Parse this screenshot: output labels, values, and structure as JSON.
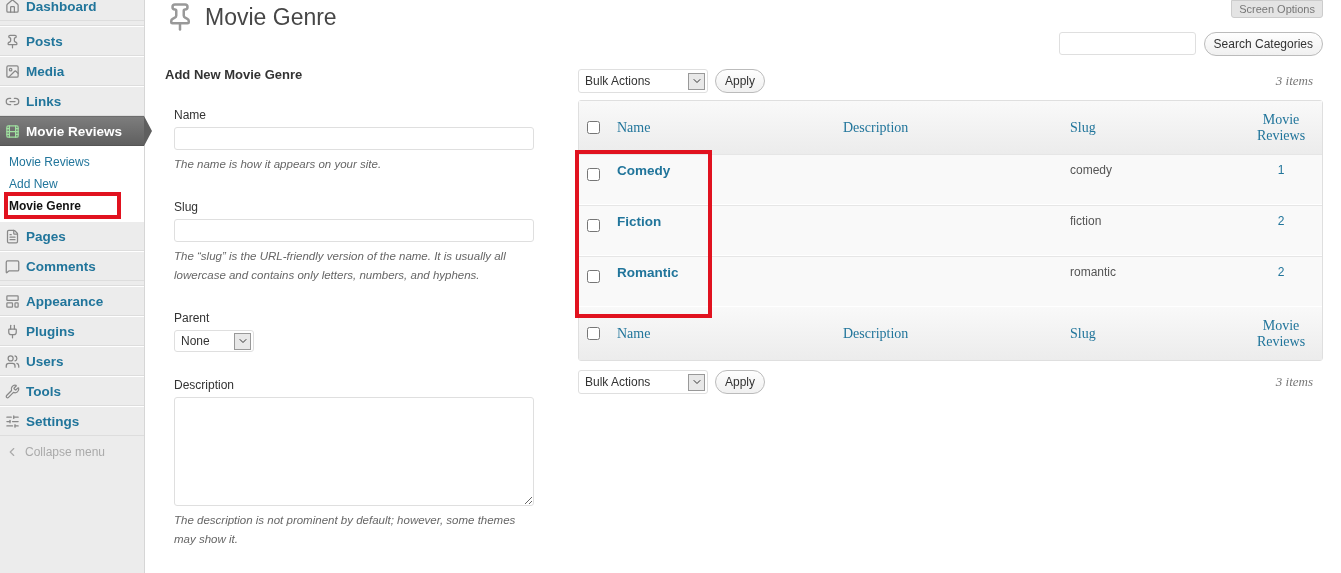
{
  "sidebar": {
    "items": [
      {
        "kind": "item",
        "label": "Dashboard",
        "current": false
      },
      {
        "kind": "separator"
      },
      {
        "kind": "item",
        "label": "Posts",
        "current": false
      },
      {
        "kind": "item",
        "label": "Media",
        "current": false
      },
      {
        "kind": "item",
        "label": "Links",
        "current": false
      },
      {
        "kind": "item",
        "label": "Movie Reviews",
        "current": true,
        "children": [
          {
            "label": "Movie Reviews",
            "selected": false,
            "annotated": false
          },
          {
            "label": "Add New",
            "selected": false,
            "annotated": false
          },
          {
            "label": "Movie Genre",
            "selected": true,
            "annotated": true
          }
        ]
      },
      {
        "kind": "item",
        "label": "Pages",
        "current": false
      },
      {
        "kind": "item",
        "label": "Comments",
        "current": false
      },
      {
        "kind": "separator"
      },
      {
        "kind": "item",
        "label": "Appearance",
        "current": false
      },
      {
        "kind": "item",
        "label": "Plugins",
        "current": false
      },
      {
        "kind": "item",
        "label": "Users",
        "current": false
      },
      {
        "kind": "item",
        "label": "Tools",
        "current": false
      },
      {
        "kind": "item",
        "label": "Settings",
        "current": false
      },
      {
        "kind": "collapse",
        "label": "Collapse menu"
      }
    ]
  },
  "header": {
    "title": "Movie Genre",
    "screen_options": "Screen Options",
    "search_button": "Search Categories"
  },
  "form": {
    "title": "Add New Movie Genre",
    "fields": [
      {
        "kind": "text",
        "label": "Name",
        "hint": "The name is how it appears on your site."
      },
      {
        "kind": "text",
        "label": "Slug",
        "hint": "The “slug” is the URL-friendly version of the name. It is usually all lowercase and contains only letters, numbers, and hyphens."
      },
      {
        "kind": "select",
        "label": "Parent",
        "value": "None"
      },
      {
        "kind": "textarea",
        "label": "Description",
        "hint": "The description is not prominent by default; however, some themes may show it."
      }
    ]
  },
  "table": {
    "top_nav": {
      "bulk": "Bulk Actions",
      "apply": "Apply",
      "count": "3 items"
    },
    "header_checked": false,
    "columns": [
      "Name",
      "Description",
      "Slug",
      "Movie Reviews"
    ],
    "rows": [
      {
        "name": "Comedy",
        "slug": "comedy",
        "count": "1",
        "checked": false
      },
      {
        "name": "Fiction",
        "slug": "fiction",
        "count": "2",
        "checked": false
      },
      {
        "name": "Romantic",
        "slug": "romantic",
        "count": "2",
        "checked": false
      }
    ],
    "name_column_annotated": true,
    "footer_checked": false,
    "footer_columns": [
      "Name",
      "Description",
      "Slug",
      "Movie Reviews"
    ],
    "bottom_nav": {
      "bulk": "Bulk Actions",
      "apply": "Apply",
      "count": "3 items"
    }
  }
}
